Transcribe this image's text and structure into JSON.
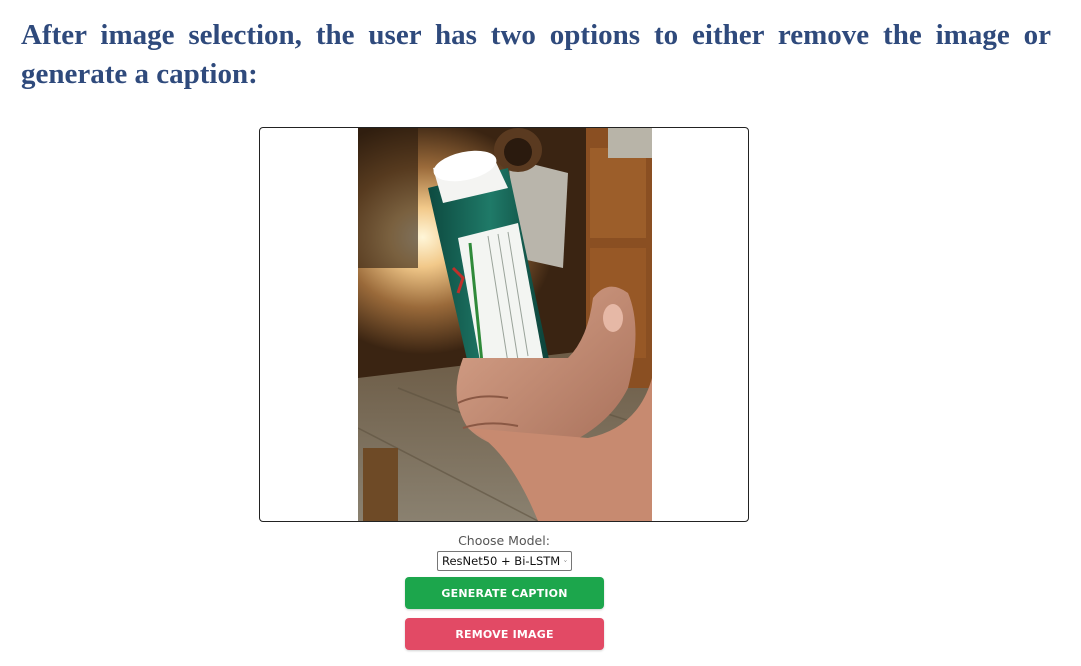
{
  "heading": "After image selection, the user has two options to either remove the image or generate a caption:",
  "model_picker": {
    "label": "Choose Model:",
    "selected": "ResNet50 + Bi-LSTM"
  },
  "buttons": {
    "generate": "GENERATE CAPTION",
    "remove": "REMOVE IMAGE"
  },
  "colors": {
    "heading": "#2f4a7c",
    "generate_button": "#1ca64c",
    "remove_button": "#e24a65"
  },
  "icons": {
    "select_arrow": "chevron-down-icon"
  }
}
